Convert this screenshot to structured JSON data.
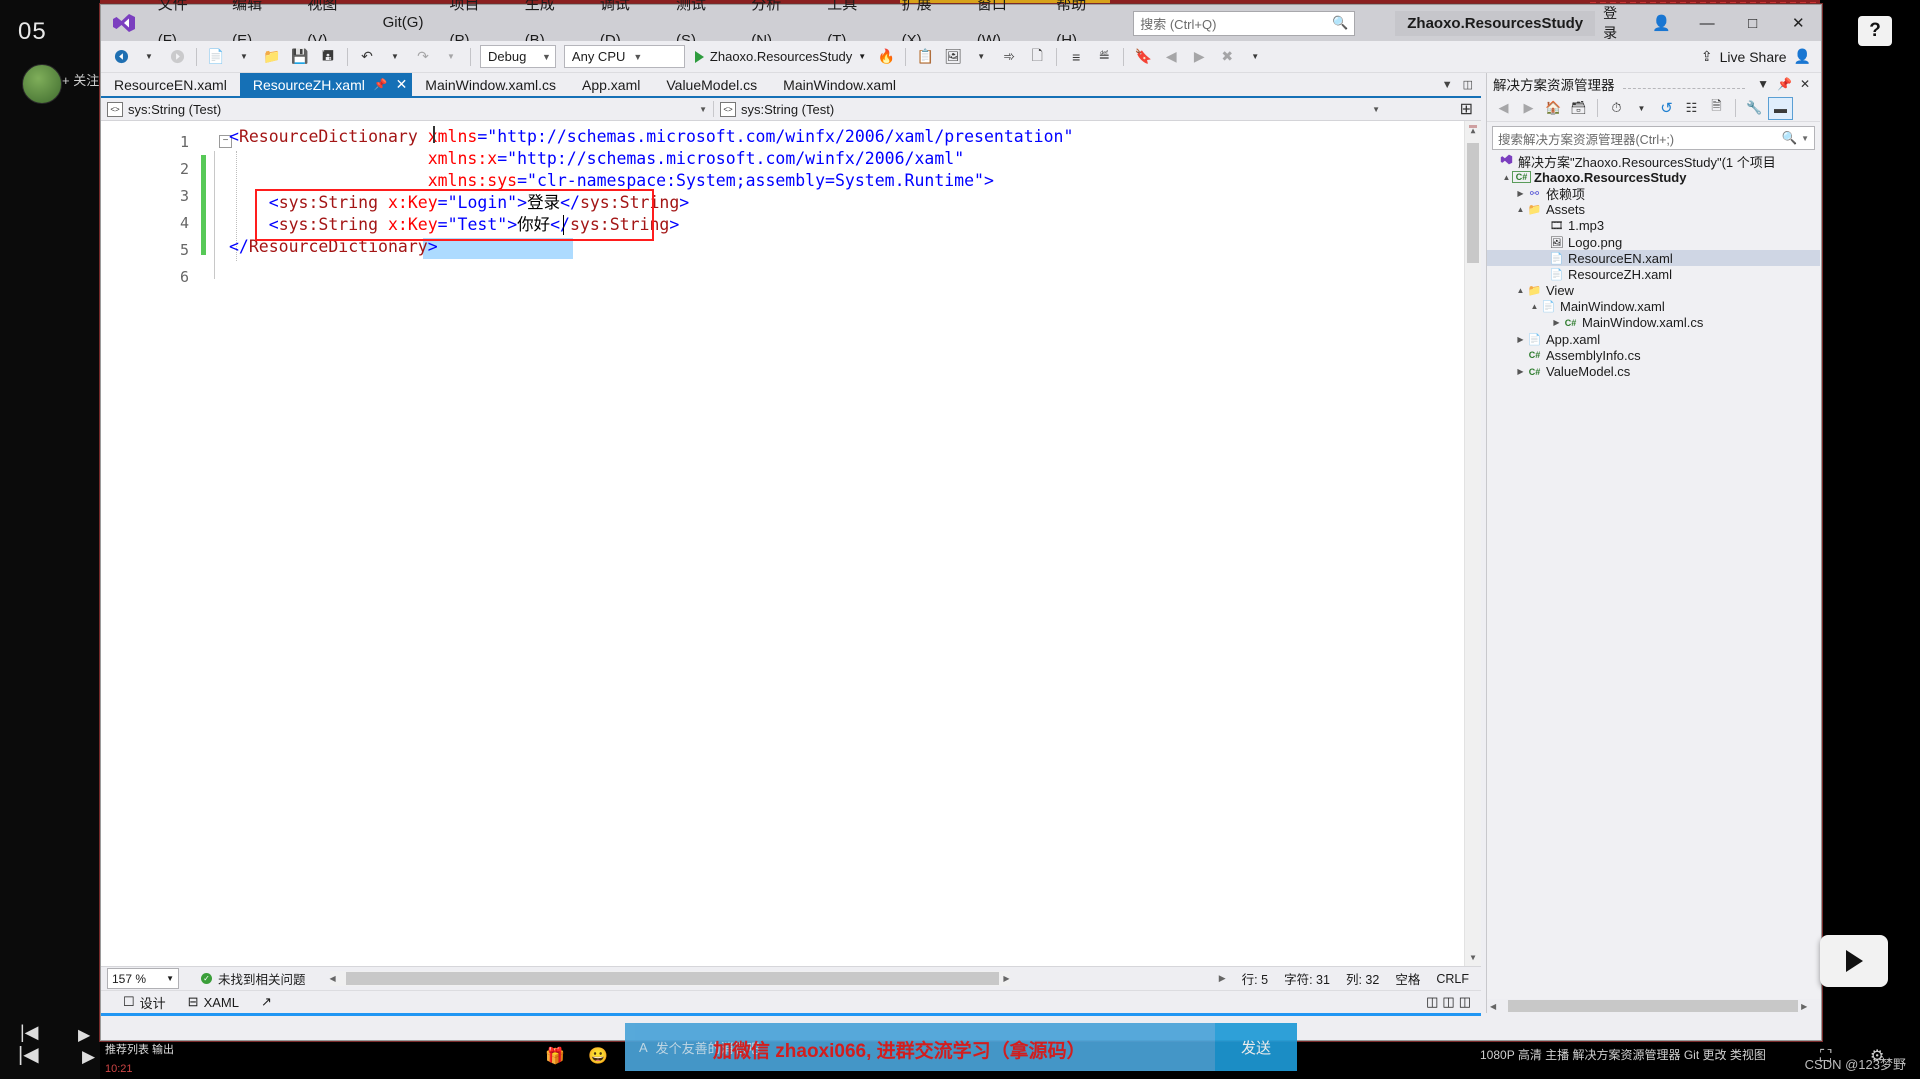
{
  "rail": {
    "clock": "05",
    "follow_label": "+ 关注",
    "vertical_label": "关注"
  },
  "window": {
    "title": "Zhaoxo.ResourcesStudy",
    "signin_label": "登录",
    "minimize": "—",
    "maximize": "□",
    "close": "✕",
    "help_badge": "?"
  },
  "menu": {
    "items": [
      {
        "label": "文件(F)",
        "name": "menu-file"
      },
      {
        "label": "编辑(E)",
        "name": "menu-edit"
      },
      {
        "label": "视图(V)",
        "name": "menu-view"
      },
      {
        "label": "Git(G)",
        "name": "menu-git"
      },
      {
        "label": "项目(P)",
        "name": "menu-project"
      },
      {
        "label": "生成(B)",
        "name": "menu-build"
      },
      {
        "label": "调试(D)",
        "name": "menu-debug"
      },
      {
        "label": "测试(S)",
        "name": "menu-test"
      },
      {
        "label": "分析(N)",
        "name": "menu-analyze"
      },
      {
        "label": "工具(T)",
        "name": "menu-tools"
      },
      {
        "label": "扩展(X)",
        "name": "menu-extensions"
      },
      {
        "label": "窗口(W)",
        "name": "menu-window"
      },
      {
        "label": "帮助(H)",
        "name": "menu-help"
      }
    ]
  },
  "search": {
    "placeholder": "搜索 (Ctrl+Q)",
    "icon": "search-icon"
  },
  "toolbar": {
    "configuration": "Debug",
    "platform": "Any CPU",
    "run_target": "Zhaoxo.ResourcesStudy",
    "live_share": "Live Share"
  },
  "document_tabs": [
    {
      "label": "ResourceEN.xaml",
      "active": false
    },
    {
      "label": "ResourceZH.xaml",
      "active": true
    },
    {
      "label": "MainWindow.xaml.cs",
      "active": false
    },
    {
      "label": "App.xaml",
      "active": false
    },
    {
      "label": "ValueModel.cs",
      "active": false
    },
    {
      "label": "MainWindow.xaml",
      "active": false
    }
  ],
  "navbar": {
    "left_scope": "sys:String (Test)",
    "right_scope": "sys:String (Test)"
  },
  "code": {
    "lines": [
      {
        "num": "1",
        "text": "<ResourceDictionary xmlns=\"http://schemas.microsoft.com/winfx/2006/xaml/presentation\""
      },
      {
        "num": "2",
        "text": "                    xmlns:x=\"http://schemas.microsoft.com/winfx/2006/xaml\""
      },
      {
        "num": "3",
        "text": "                    xmlns:sys=\"clr-namespace:System;assembly=System.Runtime\">"
      },
      {
        "num": "4",
        "text": "    <sys:String x:Key=\"Login\">登录</sys:String>"
      },
      {
        "num": "5",
        "text": "    <sys:String x:Key=\"Test\">你好</sys:String>"
      },
      {
        "num": "6",
        "text": "</ResourceDictionary>"
      }
    ]
  },
  "editor_status": {
    "zoom": "157 %",
    "issues": "未找到相关问题",
    "line_label": "行:",
    "line_value": "5",
    "char_label": "字符:",
    "char_value": "31",
    "col_label": "列:",
    "col_value": "32",
    "spaces": "空格",
    "eol": "CRLF"
  },
  "designer_tabs": [
    {
      "label": "设计",
      "name": "tab-design"
    },
    {
      "label": "XAML",
      "name": "tab-xaml"
    }
  ],
  "solution_explorer": {
    "title": "解决方案资源管理器",
    "search_placeholder": "搜索解决方案资源管理器(Ctrl+;)",
    "solution_row": "解决方案\"Zhaoxo.ResourcesStudy\"(1 个项目",
    "tree": [
      {
        "label": "Zhaoxo.ResourcesStudy",
        "indent": 1,
        "arrow": "▲",
        "icon": "csharp-project-icon",
        "glyph": "C#",
        "bold": true,
        "selected": false
      },
      {
        "label": "依赖项",
        "indent": 2,
        "arrow": "▶",
        "icon": "dependencies-icon",
        "glyph": "⚯",
        "bold": false,
        "selected": false
      },
      {
        "label": "Assets",
        "indent": 2,
        "arrow": "▲",
        "icon": "folder-icon",
        "glyph": "📁",
        "bold": false,
        "selected": false
      },
      {
        "label": "1.mp3",
        "indent": 3,
        "arrow": "",
        "icon": "audio-file-icon",
        "glyph": "🎞",
        "bold": false,
        "selected": false
      },
      {
        "label": "Logo.png",
        "indent": 3,
        "arrow": "",
        "icon": "image-file-icon",
        "glyph": "🖼",
        "bold": false,
        "selected": false
      },
      {
        "label": "ResourceEN.xaml",
        "indent": 3,
        "arrow": "",
        "icon": "xaml-file-icon",
        "glyph": "📄",
        "bold": false,
        "selected": true
      },
      {
        "label": "ResourceZH.xaml",
        "indent": 3,
        "arrow": "",
        "icon": "xaml-file-icon",
        "glyph": "📄",
        "bold": false,
        "selected": false
      },
      {
        "label": "View",
        "indent": 2,
        "arrow": "▲",
        "icon": "folder-icon",
        "glyph": "📁",
        "bold": false,
        "selected": false
      },
      {
        "label": "MainWindow.xaml",
        "indent": 3,
        "arrow": "▲",
        "icon": "xaml-file-icon",
        "glyph": "📄",
        "bold": false,
        "selected": false
      },
      {
        "label": "MainWindow.xaml.cs",
        "indent": 4,
        "arrow": "▶",
        "icon": "csharp-file-icon",
        "glyph": "C#",
        "bold": false,
        "selected": false
      },
      {
        "label": "App.xaml",
        "indent": 2,
        "arrow": "▶",
        "icon": "xaml-file-icon",
        "glyph": "📄",
        "bold": false,
        "selected": false
      },
      {
        "label": "AssemblyInfo.cs",
        "indent": 2,
        "arrow": "",
        "icon": "csharp-file-icon",
        "glyph": "C#",
        "bold": false,
        "selected": false
      },
      {
        "label": "ValueModel.cs",
        "indent": 2,
        "arrow": "▶",
        "icon": "csharp-file-icon",
        "glyph": "C#",
        "bold": false,
        "selected": false
      }
    ]
  },
  "taskbar": {
    "time": "10:21",
    "left_items": "推荐列表   输出",
    "chat_placeholder": "发个友善的消息吧",
    "chat_message": "加微信 zhaoxi066, 进群交流学习（拿源码）",
    "send_label": "发送",
    "right_info": "1080P 高清  主播   解决方案资源管理器   Git 更改   类视图",
    "watermark": "CSDN @123梦野"
  },
  "colors": {
    "accent_blue": "#1570b6",
    "highlight_red": "#ff1d1d",
    "selection_blue": "#addbff",
    "chat_blue": "#4aa3d8",
    "change_green": "#57c957"
  }
}
